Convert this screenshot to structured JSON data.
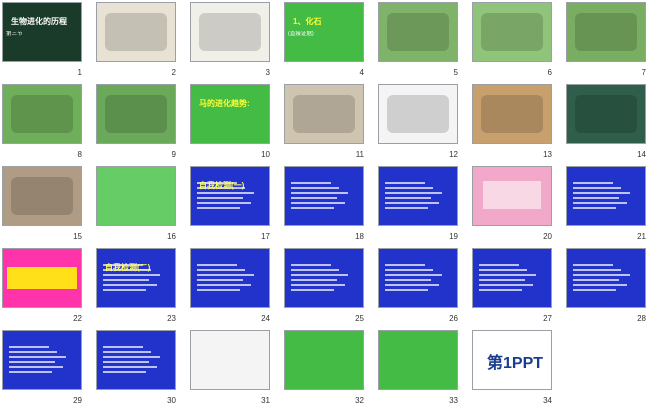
{
  "slides": [
    {
      "num": "1",
      "bg": "#1a3b2a",
      "text": "生物进化的历程",
      "sub": "第三节",
      "kind": "title"
    },
    {
      "num": "2",
      "bg": "#e7e2d3",
      "text": "",
      "kind": "fossil"
    },
    {
      "num": "3",
      "bg": "#f0efe8",
      "text": "",
      "kind": "fossil2"
    },
    {
      "num": "4",
      "bg": "#44bb44",
      "text": "1、化石",
      "sub": "(直接证据)",
      "kind": "green"
    },
    {
      "num": "5",
      "bg": "#7fb36a",
      "text": "",
      "kind": "horse"
    },
    {
      "num": "6",
      "bg": "#8fc47a",
      "text": "",
      "kind": "horse"
    },
    {
      "num": "7",
      "bg": "#79ad62",
      "text": "",
      "kind": "horse"
    },
    {
      "num": "8",
      "bg": "#6fae5a",
      "text": "",
      "kind": "horse"
    },
    {
      "num": "9",
      "bg": "#6aa85a",
      "text": "",
      "kind": "horse"
    },
    {
      "num": "10",
      "bg": "#44bb44",
      "text": "马的进化趋势:",
      "kind": "green"
    },
    {
      "num": "11",
      "bg": "#cfc4b0",
      "text": "",
      "kind": "fossil"
    },
    {
      "num": "12",
      "bg": "#f4f4f4",
      "text": "",
      "kind": "bird"
    },
    {
      "num": "13",
      "bg": "#c7a06e",
      "text": "",
      "kind": "fossil"
    },
    {
      "num": "14",
      "bg": "#2f5e4a",
      "text": "",
      "kind": "skeleton"
    },
    {
      "num": "15",
      "bg": "#b09c84",
      "text": "",
      "kind": "bird"
    },
    {
      "num": "16",
      "bg": "#66cc66",
      "text": "",
      "kind": "green"
    },
    {
      "num": "17",
      "bg": "#2233cc",
      "text": "自我检测(一)",
      "kind": "blue"
    },
    {
      "num": "18",
      "bg": "#2233cc",
      "text": "",
      "kind": "blue"
    },
    {
      "num": "19",
      "bg": "#2233cc",
      "text": "",
      "kind": "tree"
    },
    {
      "num": "20",
      "bg": "#f2a8c8",
      "text": "",
      "kind": "pink"
    },
    {
      "num": "21",
      "bg": "#2233cc",
      "text": "",
      "kind": "blueimg"
    },
    {
      "num": "22",
      "bg": "#ff33aa",
      "text": "",
      "kind": "magenta"
    },
    {
      "num": "23",
      "bg": "#2233cc",
      "text": "自我检测(二)",
      "kind": "blue"
    },
    {
      "num": "24",
      "bg": "#2233cc",
      "text": "",
      "kind": "blue"
    },
    {
      "num": "25",
      "bg": "#2233cc",
      "text": "",
      "kind": "blue"
    },
    {
      "num": "26",
      "bg": "#2233cc",
      "text": "",
      "kind": "table"
    },
    {
      "num": "27",
      "bg": "#2233cc",
      "text": "",
      "kind": "blue"
    },
    {
      "num": "28",
      "bg": "#2233cc",
      "text": "",
      "kind": "blue"
    },
    {
      "num": "29",
      "bg": "#2233cc",
      "text": "",
      "kind": "blue"
    },
    {
      "num": "30",
      "bg": "#2233cc",
      "text": "",
      "kind": "blue"
    },
    {
      "num": "31",
      "bg": "#f4f4f4",
      "text": "",
      "kind": "tree2"
    },
    {
      "num": "32",
      "bg": "#44bb44",
      "text": "",
      "kind": "green"
    },
    {
      "num": "33",
      "bg": "#44bb44",
      "text": "",
      "kind": "green"
    },
    {
      "num": "34",
      "bg": "#ffffff",
      "text": "第1PPT",
      "kind": "logo"
    }
  ]
}
